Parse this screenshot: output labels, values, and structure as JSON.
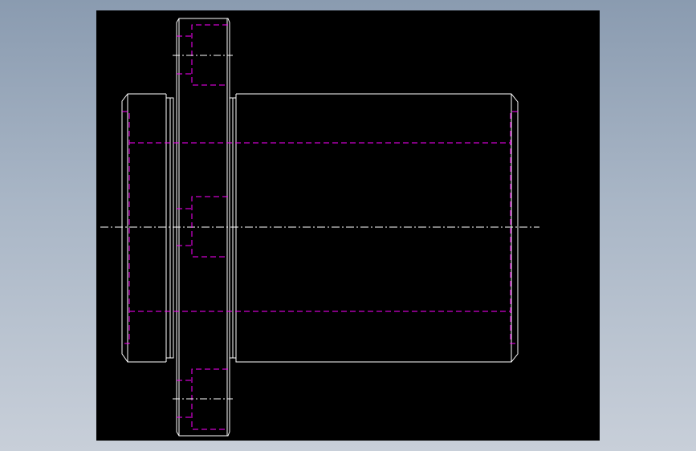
{
  "viewport": {
    "background_gradient": [
      "#8a9bb0",
      "#c8cfd9"
    ],
    "canvas_color": "#000000"
  },
  "drawing": {
    "colors": {
      "outline": "#ffffff",
      "hidden_lines": "#ff00ff",
      "center_lines": "#ffffff"
    },
    "views": [
      {
        "name": "front-view",
        "parts": [
          "left-hub",
          "flange",
          "right-cylinder"
        ],
        "hidden_features": [
          "bore-lines",
          "flange-holes"
        ],
        "center_lines": [
          "main-axis",
          "flange-hole-axes"
        ]
      }
    ]
  }
}
